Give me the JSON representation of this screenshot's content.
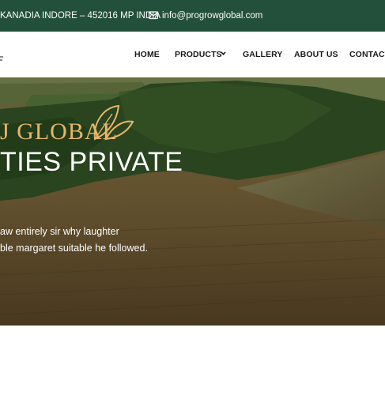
{
  "topbar": {
    "address": "KANADIA INDORE – 452016 MP INDIA",
    "email": "info@progrowglobal.com",
    "icon": "mail-icon"
  },
  "nav": {
    "items": [
      "HOME",
      "PRODUCTS",
      "GALLERY",
      "ABOUT US",
      "CONTACT"
    ]
  },
  "hero": {
    "brand": "J GLOBAL",
    "subtitle": "TIES PRIVATE",
    "text_line_1": "aw entirely sir why laughter",
    "text_line_2": "ble margaret suitable he followed."
  },
  "colors": {
    "topbar": "#23503a",
    "accent": "#e6b56a"
  }
}
